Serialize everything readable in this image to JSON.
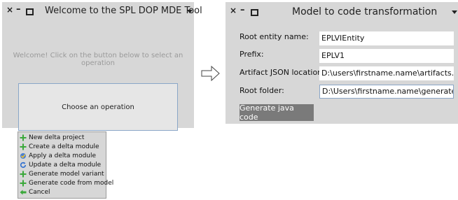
{
  "window1": {
    "title": "Welcome to the SPL DOP MDE Tool",
    "controls": {
      "close": "×",
      "minimize": "–"
    },
    "welcome_text": "Welcome! Click on the button below to select an operation",
    "choose_button": "Choose an operation"
  },
  "menu": {
    "items": [
      {
        "label": "New delta project",
        "icon": "plus-icon"
      },
      {
        "label": "Create a delta module",
        "icon": "plus-icon"
      },
      {
        "label": "Apply a delta module",
        "icon": "apply-icon"
      },
      {
        "label": "Update a delta module",
        "icon": "refresh-icon"
      },
      {
        "label": "Generate model variant",
        "icon": "plus-icon"
      },
      {
        "label": "Generate code from model",
        "icon": "plus-icon"
      },
      {
        "label": "Cancel",
        "icon": "back-arrow-icon"
      }
    ]
  },
  "window2": {
    "title": "Model to code transformation",
    "controls": {
      "close": "×",
      "minimize": "–"
    },
    "fields": [
      {
        "label": "Root entity name:",
        "value": "EPLVIEntity"
      },
      {
        "label": "Prefix:",
        "value": "EPLV1"
      },
      {
        "label": "Artifact JSON location:",
        "value": "D:\\users\\firstname.name\\artifacts.json"
      },
      {
        "label": "Root folder:",
        "value": "D:\\Users\\firstname.name\\generated\\src"
      }
    ],
    "generate_button": "Generate java code"
  },
  "colors": {
    "window_bg": "#d7d7d7",
    "focus_border": "#8aa6c8",
    "plus_green": "#3aa83a",
    "button_dark": "#7a7a7a"
  }
}
